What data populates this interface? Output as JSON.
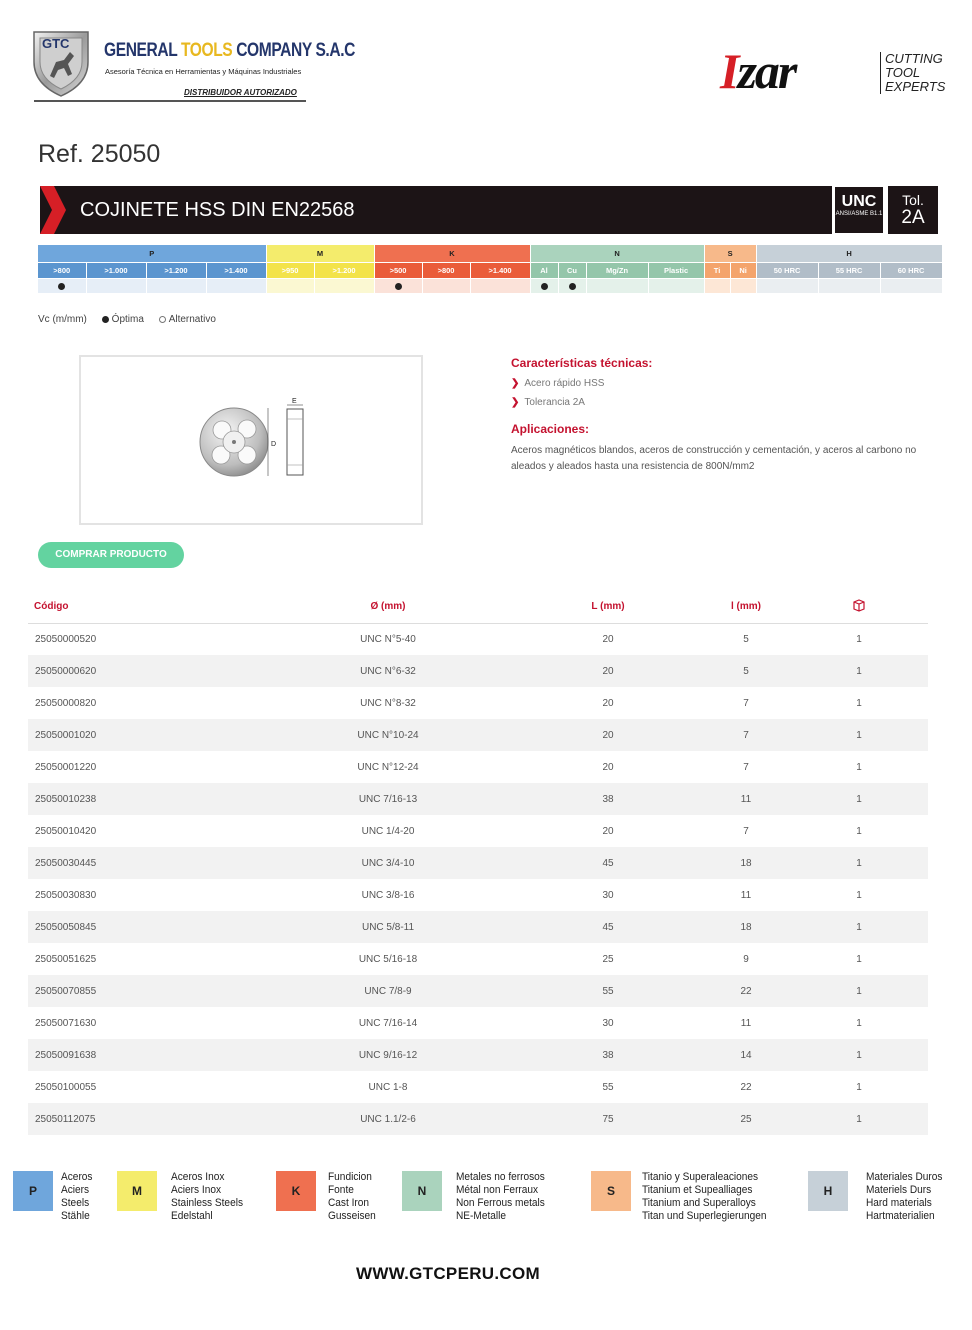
{
  "header": {
    "gtc": {
      "badge": "GTC",
      "company_part1": "GENERAL ",
      "company_part2": "TOOLS",
      "company_part3": " COMPANY S.A.C",
      "tagline": "Asesoría Técnica en Herramientas y Máquinas Industriales",
      "distributor": "DISTRIBUIDOR AUTORIZADO"
    },
    "brand": {
      "wordmark_first": "I",
      "wordmark_rest": "zar",
      "tagline_lines": [
        "CUTTING",
        "TOOL",
        "EXPERTS"
      ]
    }
  },
  "product": {
    "ref": "Ref. 25050",
    "title": "COJINETE HSS DIN EN22568",
    "thread_standard": "UNC",
    "thread_standard_sub": "ANSI/ASME B1.1",
    "tolerance_label": "Tol.",
    "tolerance_value": "2A"
  },
  "materials_grid": {
    "groups": [
      {
        "letter": "P",
        "subs": [
          ">800",
          ">1.000",
          ">1.200",
          ">1.400"
        ],
        "optimal": [
          true,
          false,
          false,
          false
        ]
      },
      {
        "letter": "M",
        "subs": [
          ">950",
          ">1.200"
        ],
        "optimal": [
          false,
          false
        ]
      },
      {
        "letter": "K",
        "subs": [
          ">500",
          ">800",
          ">1.400"
        ],
        "optimal": [
          true,
          false,
          false
        ]
      },
      {
        "letter": "N",
        "subs": [
          "Al",
          "Cu",
          "Mg/Zn",
          "Plastic"
        ],
        "optimal": [
          true,
          true,
          false,
          false
        ]
      },
      {
        "letter": "S",
        "subs": [
          "Ti",
          "Ni"
        ],
        "optimal": [
          false,
          false
        ]
      },
      {
        "letter": "H",
        "subs": [
          "50 HRC",
          "55 HRC",
          "60 HRC"
        ],
        "optimal": [
          false,
          false,
          false
        ]
      }
    ],
    "colors": {
      "P": "#6fa6dc",
      "M": "#f4ec6c",
      "K": "#ef7050",
      "N": "#aad3bd",
      "S": "#f7b98a",
      "H": "#c6d0d8"
    }
  },
  "legend": {
    "vc": "Vc (m/mm)",
    "optimal": "Óptima",
    "alternative": "Alternativo"
  },
  "drawing": {
    "label_e": "E",
    "label_d": "D"
  },
  "features": {
    "title": "Características técnicas:",
    "items": [
      "Acero rápido HSS",
      "Tolerancia 2A"
    ],
    "applications_title": "Aplicaciones:",
    "applications_text": "Aceros magnéticos blandos, aceros de construcción y cementación, y aceros al carbono no aleados y aleados hasta una resistencia de 800N/mm2"
  },
  "buy_button": "COMPRAR PRODUCTO",
  "table": {
    "headers": {
      "code": "Código",
      "diameter": "Ø (mm)",
      "length": "L (mm)",
      "l_small": "l (mm)",
      "pack_icon": "box-icon"
    },
    "rows": [
      {
        "code": "25050000520",
        "diameter": "UNC N°5-40",
        "L": "20",
        "l": "5",
        "pack": "1"
      },
      {
        "code": "25050000620",
        "diameter": "UNC N°6-32",
        "L": "20",
        "l": "5",
        "pack": "1"
      },
      {
        "code": "25050000820",
        "diameter": "UNC N°8-32",
        "L": "20",
        "l": "7",
        "pack": "1"
      },
      {
        "code": "25050001020",
        "diameter": "UNC N°10-24",
        "L": "20",
        "l": "7",
        "pack": "1"
      },
      {
        "code": "25050001220",
        "diameter": "UNC N°12-24",
        "L": "20",
        "l": "7",
        "pack": "1"
      },
      {
        "code": "25050010238",
        "diameter": "UNC 7/16-13",
        "L": "38",
        "l": "11",
        "pack": "1"
      },
      {
        "code": "25050010420",
        "diameter": "UNC 1/4-20",
        "L": "20",
        "l": "7",
        "pack": "1"
      },
      {
        "code": "25050030445",
        "diameter": "UNC 3/4-10",
        "L": "45",
        "l": "18",
        "pack": "1"
      },
      {
        "code": "25050030830",
        "diameter": "UNC 3/8-16",
        "L": "30",
        "l": "11",
        "pack": "1"
      },
      {
        "code": "25050050845",
        "diameter": "UNC 5/8-11",
        "L": "45",
        "l": "18",
        "pack": "1"
      },
      {
        "code": "25050051625",
        "diameter": "UNC 5/16-18",
        "L": "25",
        "l": "9",
        "pack": "1"
      },
      {
        "code": "25050070855",
        "diameter": "UNC 7/8-9",
        "L": "55",
        "l": "22",
        "pack": "1"
      },
      {
        "code": "25050071630",
        "diameter": "UNC 7/16-14",
        "L": "30",
        "l": "11",
        "pack": "1"
      },
      {
        "code": "25050091638",
        "diameter": "UNC 9/16-12",
        "L": "38",
        "l": "14",
        "pack": "1"
      },
      {
        "code": "25050100055",
        "diameter": "UNC 1-8",
        "L": "55",
        "l": "22",
        "pack": "1"
      },
      {
        "code": "25050112075",
        "diameter": "UNC 1.1/2-6",
        "L": "75",
        "l": "25",
        "pack": "1"
      }
    ]
  },
  "material_legend": [
    {
      "letter": "P",
      "color": "#6fa6dc",
      "names": [
        "Aceros",
        "Aciers",
        "Steels",
        "Stähle"
      ]
    },
    {
      "letter": "M",
      "color": "#f4ec6c",
      "names": [
        "Aceros Inox",
        "Aciers Inox",
        "Stainless Steels",
        "Edelstahl"
      ]
    },
    {
      "letter": "K",
      "color": "#ef7050",
      "names": [
        "Fundicion",
        "Fonte",
        "Cast Iron",
        "Gusseisen"
      ]
    },
    {
      "letter": "N",
      "color": "#aad3bd",
      "names": [
        "Metales no ferrosos",
        "Métal non Ferraux",
        "Non Ferrous metals",
        "NE-Metalle"
      ]
    },
    {
      "letter": "S",
      "color": "#f7b98a",
      "names": [
        "Titanio y Superaleaciones",
        "Titanium et Supealliages",
        "Titanium and Superalloys",
        "Titan und Superlegierungen"
      ]
    },
    {
      "letter": "H",
      "color": "#c6d0d8",
      "names": [
        "Materiales Duros",
        "Materiels Durs",
        "Hard materials",
        "Hartmaterialien"
      ]
    }
  ],
  "footer": "WWW.GTCPERU.COM"
}
